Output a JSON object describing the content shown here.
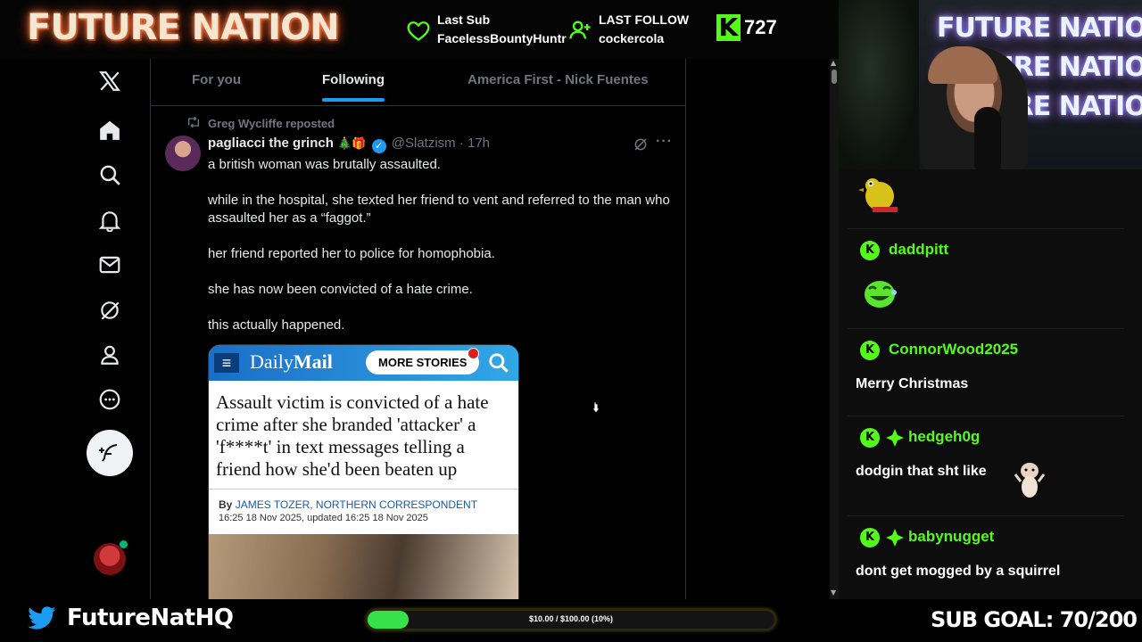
{
  "overlay": {
    "logo": "FUTURE NATION",
    "last_sub": {
      "label": "Last Sub",
      "value": "FacelessBountyHuntr"
    },
    "last_follow": {
      "label": "LAST FOLLOW",
      "value": "cockercola"
    },
    "kick_viewers": "727",
    "twitter_handle": "FutureNatHQ",
    "goal_text": "$10.00 / $100.00 (10%)",
    "goal_progress": 0.1,
    "sub_goal": "SUB GOAL: 70/200",
    "webcam_sign_lines": [
      "FUTURE NATION",
      "FUTURE NATION",
      "FUTURE NATION"
    ]
  },
  "x": {
    "tabs": [
      {
        "label": "For you"
      },
      {
        "label": "Following",
        "active": true
      },
      {
        "label": "America First - Nick Fuentes"
      }
    ],
    "nav_icons": [
      "x-logo-icon",
      "home-icon",
      "search-icon",
      "bell-icon",
      "mail-icon",
      "grok-icon",
      "profile-icon",
      "more-icon",
      "compose-icon"
    ],
    "tweet": {
      "repost_by": "Greg Wycliffe reposted",
      "name": "pagliacci the grinch",
      "name_emoji": "🎄🎁",
      "handle": "@Slatzism · 17h",
      "paragraphs": [
        "a british woman was brutally assaulted.",
        "while in the hospital, she texted her friend to vent and referred to the man who assaulted her as a “faggot.”",
        "her friend reported her to police for homophobia.",
        "she has now been convicted of a hate crime.",
        "this actually happened."
      ],
      "media": {
        "logo_daily": "Daily",
        "logo_mail": "Mail",
        "more_stories": "MORE STORIES",
        "headline": "Assault victim is convicted of a hate crime after she branded 'attacker' a 'f****t' in text messages telling a friend how she'd been beaten up",
        "byline_prefix": "By ",
        "byline_author": "JAMES TOZER, NORTHERN CORRESPONDENT",
        "date": "16:25 18 Nov 2025, updated 16:25 18 Nov 2025"
      }
    }
  },
  "chat": {
    "messages": [
      {
        "user": "daddpitt",
        "text": "",
        "badges": [
          "kick"
        ]
      },
      {
        "user": "ConnorWood2025",
        "text": "Merry Christmas",
        "badges": [
          "kick"
        ]
      },
      {
        "user": "hedgeh0g",
        "text": "dodgin that sht like",
        "badges": [
          "kick",
          "gifter"
        ]
      },
      {
        "user": "babynugget",
        "text": "dont get mogged by a squirrel",
        "badges": [
          "kick",
          "gifter"
        ]
      }
    ]
  },
  "colors": {
    "kick_green": "#53fc18",
    "x_blue": "#1d9bf0",
    "x_bg": "#000000",
    "chat_bg": "#0d0d0d"
  }
}
